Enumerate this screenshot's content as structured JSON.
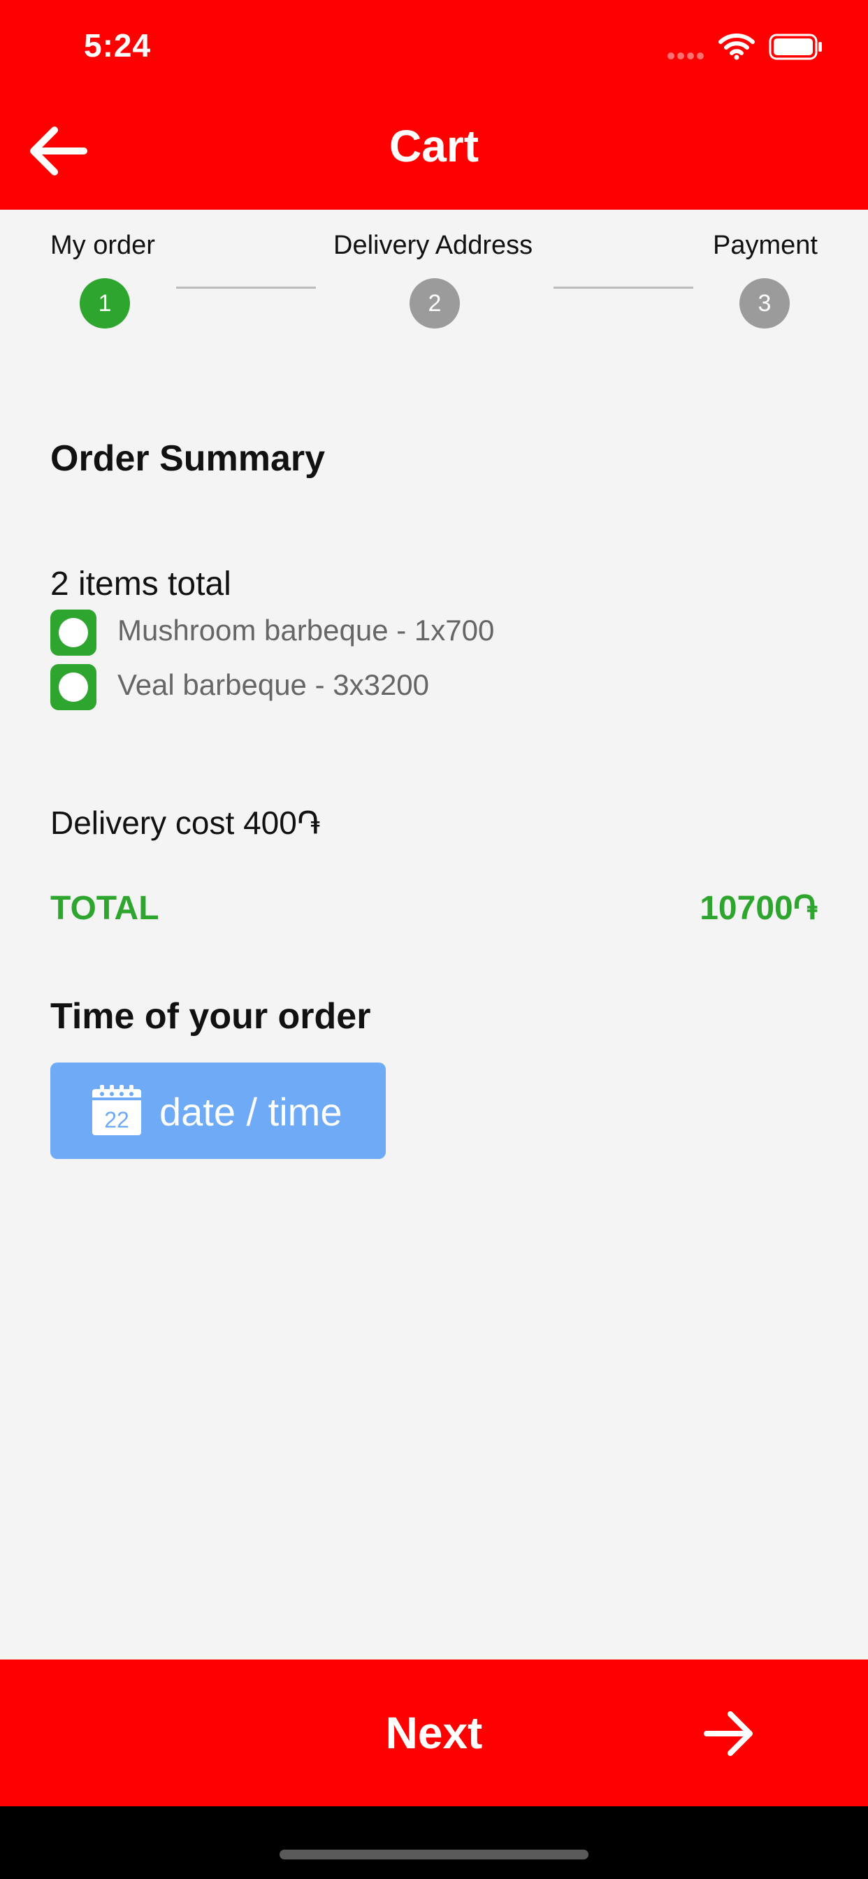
{
  "status_bar": {
    "time": "5:24"
  },
  "header": {
    "title": "Cart"
  },
  "steps": [
    {
      "label": "My order",
      "number": "1",
      "state": "active",
      "color": "#2ea52e"
    },
    {
      "label": "Delivery Address",
      "number": "2",
      "state": "inactive",
      "color": "#9b9b9b"
    },
    {
      "label": "Payment",
      "number": "3",
      "state": "inactive",
      "color": "#9b9b9b"
    }
  ],
  "summary": {
    "heading": "Order Summary",
    "items_total": "2  items total",
    "items": [
      {
        "text": "Mushroom barbeque - 1x700",
        "checked": true
      },
      {
        "text": "Veal barbeque - 3x3200",
        "checked": true
      }
    ],
    "delivery_cost": "Delivery cost 400֏",
    "total_label": "TOTAL",
    "total_value": "10700֏"
  },
  "order_time": {
    "heading": "Time of your order",
    "button_label": "date / time",
    "calendar_day": "22"
  },
  "footer": {
    "next_label": "Next"
  },
  "colors": {
    "primary": "#ff0000",
    "accent_green": "#2ea52e",
    "button_blue": "#6eaaf5",
    "background": "#f4f4f4"
  }
}
